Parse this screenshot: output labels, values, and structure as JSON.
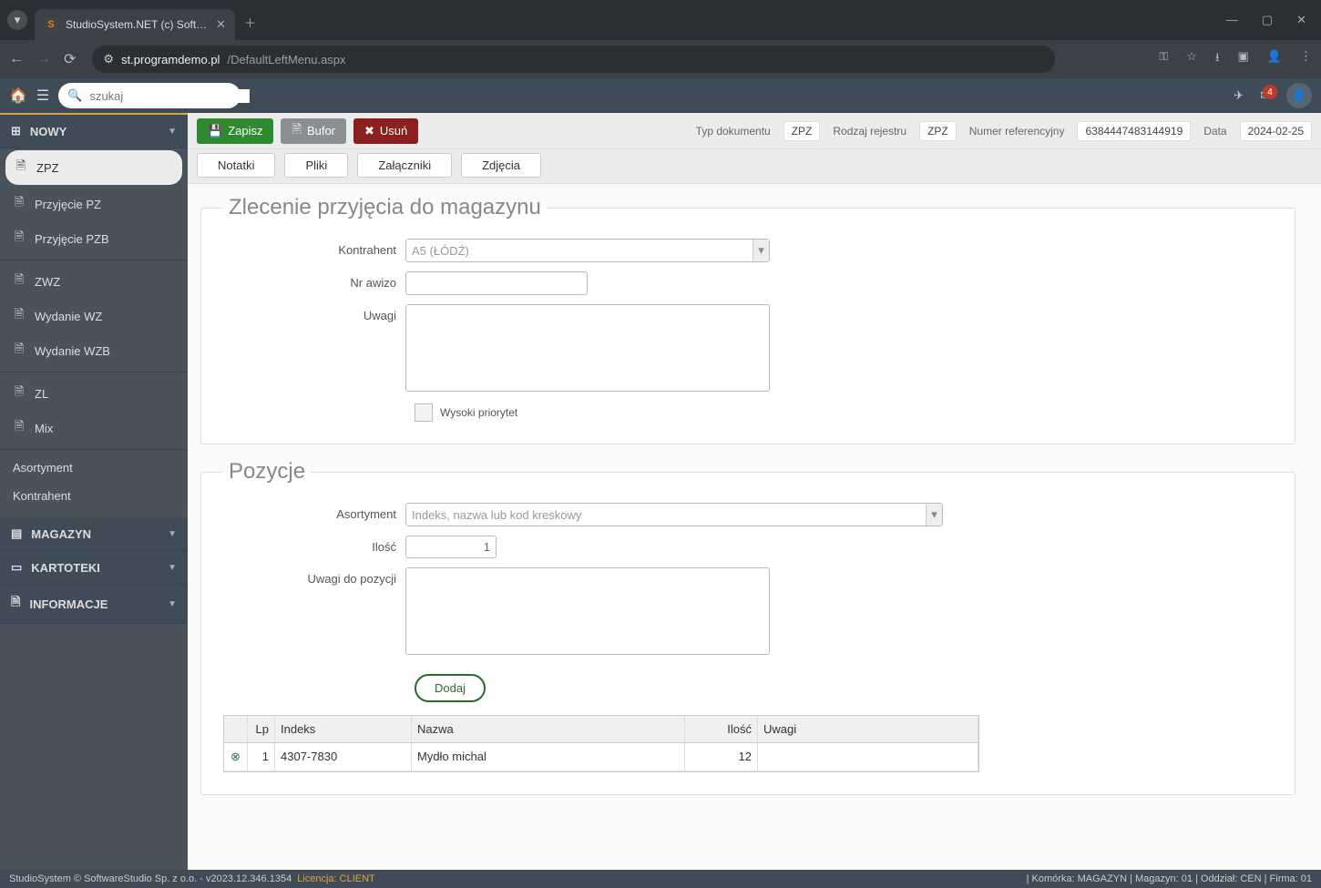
{
  "browser": {
    "tab_title": "StudioSystem.NET (c) SoftwareS",
    "tab_favicon_letter": "S",
    "url_host": "st.programdemo.pl",
    "url_path": "/DefaultLeftMenu.aspx"
  },
  "topbar": {
    "search_placeholder": "szukaj",
    "badge_count": "4"
  },
  "sidebar": {
    "sections": {
      "nowy": "NOWY",
      "magazyn": "MAGAZYN",
      "kartoteki": "KARTOTEKI",
      "informacje": "INFORMACJE"
    },
    "items": [
      "ZPZ",
      "Przyjęcie PZ",
      "Przyjęcie PZB",
      "ZWZ",
      "Wydanie WZ",
      "Wydanie WZB",
      "ZL",
      "Mix"
    ],
    "links": [
      "Asortyment",
      "Kontrahent"
    ]
  },
  "actions": {
    "save": "Zapisz",
    "buffer": "Bufor",
    "delete": "Usuń"
  },
  "doc_meta": {
    "typ_label": "Typ dokumentu",
    "typ_val": "ZPZ",
    "rejestr_label": "Rodzaj rejestru",
    "rejestr_val": "ZPZ",
    "numer_label": "Numer referencyjny",
    "numer_val": "6384447483144919",
    "data_label": "Data",
    "data_val": "2024-02-25"
  },
  "subtabs": [
    "Notatki",
    "Pliki",
    "Załączniki",
    "Zdjęcia"
  ],
  "section1": {
    "title": "Zlecenie przyjęcia do magazynu",
    "kontrahent_label": "Kontrahent",
    "kontrahent_value": "A5 (ŁÓDŹ)",
    "awizo_label": "Nr awizo",
    "uwagi_label": "Uwagi",
    "priorytet_label": "Wysoki priorytet"
  },
  "section2": {
    "title": "Pozycje",
    "asortyment_label": "Asortyment",
    "asortyment_placeholder": "Indeks, nazwa lub kod kreskowy",
    "ilosc_label": "Ilość",
    "ilosc_value": "1",
    "uwagi_poz_label": "Uwagi do pozycji",
    "dodaj_label": "Dodaj"
  },
  "grid": {
    "headers": {
      "lp": "Lp",
      "indeks": "Indeks",
      "nazwa": "Nazwa",
      "ilosc": "Ilość",
      "uwagi": "Uwagi"
    },
    "rows": [
      {
        "lp": "1",
        "indeks": "4307-7830",
        "nazwa": "Mydło michal",
        "ilosc": "12",
        "uwagi": ""
      }
    ]
  },
  "footer": {
    "left": "StudioSystem © SoftwareStudio Sp. z o.o. - v2023.12.346.1354",
    "license_label": "Licencja: CLIENT",
    "right": "| Komórka: MAGAZYN | Magazyn: 01 | Oddział: CEN | Firma: 01"
  }
}
